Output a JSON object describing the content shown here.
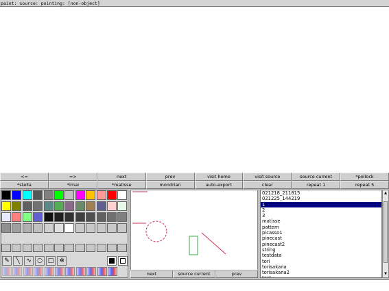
{
  "status_bar": {
    "text": "paint: source: pointing: [non-object]"
  },
  "buttons_row1": [
    "<=",
    "=>",
    "next",
    "prev",
    "visit home",
    "visit source",
    "source current",
    "*pollock"
  ],
  "buttons_row2": [
    "*stella",
    "*imai",
    "*matisse",
    "mondrian",
    "auto-export",
    "clear",
    "repeat 1",
    "repeat 5"
  ],
  "palette": {
    "colors_row1": [
      "#000000",
      "#0000ff",
      "#00ffff",
      "#555555",
      "#808080",
      "#00ff00",
      "#c0c0c0",
      "#ff00ff",
      "#ffc000",
      "#ff9999",
      "#ff0000",
      "#ffffff"
    ],
    "colors_row2": [
      "#ffff00",
      "#808000",
      "#606060",
      "#707070",
      "#5a8a8a",
      "#55aa55",
      "#8a6a8a",
      "#6a8a6a",
      "#a08050",
      "#606090",
      "#ffd0d0",
      "#e8f8e8"
    ],
    "colors_row3": [
      "#e8e8ff",
      "#ff8080",
      "#80ff80",
      "#6060d0",
      "#101010",
      "#202020",
      "#303030",
      "#404040",
      "#505050",
      "#606060",
      "#707070",
      "#808080"
    ],
    "colors_row4": [
      "#909090",
      "#a0a0a0",
      "#b0b0b0",
      "#c0c0c0",
      "#d0d0d0",
      "#e0e0e0",
      "#ffffff",
      "#c8c8c8",
      "#c8c8c8",
      "#c8c8c8",
      "#c8c8c8",
      "#c8c8c8"
    ],
    "tools": [
      "pencil-tool",
      "line-tool",
      "curve-tool",
      "circle-tool",
      "rect-tool",
      "spray-tool"
    ]
  },
  "preview_buttons": [
    "next",
    "source current",
    "prev"
  ],
  "list": {
    "items": [
      "021218_211815",
      "021225_144219",
      "1",
      "2",
      "3",
      "matisse",
      "pattern",
      "picasso1",
      "pinecast",
      "pinecast2",
      "string",
      "testdata",
      "tori",
      "torisakana",
      "torisakana2",
      "test"
    ],
    "selected_index": 2
  },
  "colors": {
    "selection": "#000080",
    "stroke_red": "#cc3355",
    "stroke_green": "#33aa44"
  }
}
